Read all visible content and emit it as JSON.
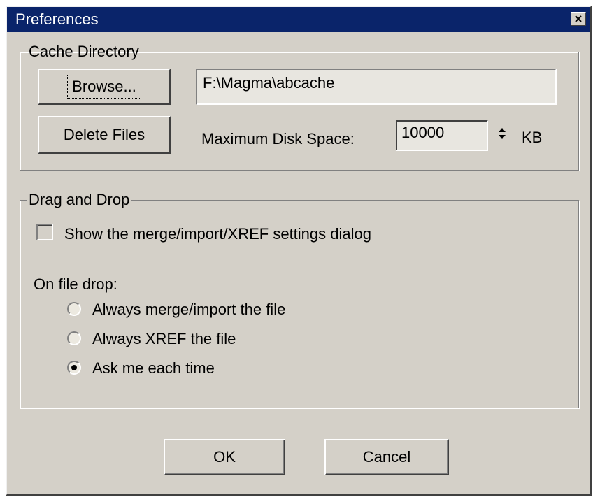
{
  "window": {
    "title": "Preferences",
    "close_icon": "close-icon"
  },
  "cache_directory": {
    "legend": "Cache Directory",
    "browse_label": "Browse...",
    "path_value": "F:\\Magma\\abcache",
    "delete_label": "Delete Files",
    "max_disk_label": "Maximum Disk Space:",
    "max_disk_value": "10000",
    "unit": "KB"
  },
  "drag_and_drop": {
    "legend": "Drag and Drop",
    "show_settings_label": "Show the merge/import/XREF settings dialog",
    "show_settings_checked": false,
    "on_file_drop_label": "On file drop:",
    "options": [
      {
        "label": "Always merge/import the file",
        "checked": false
      },
      {
        "label": "Always XREF the file",
        "checked": false
      },
      {
        "label": "Ask me each time",
        "checked": true
      }
    ]
  },
  "footer": {
    "ok_label": "OK",
    "cancel_label": "Cancel"
  },
  "colors": {
    "titlebar": "#0a246a",
    "face": "#d4d0c8"
  }
}
